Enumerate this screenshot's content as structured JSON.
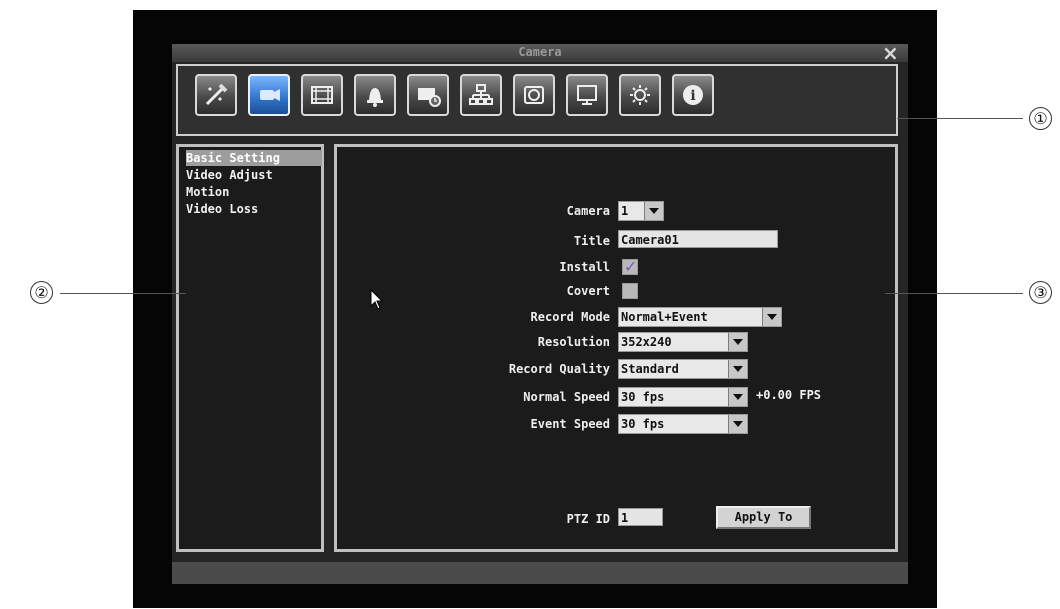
{
  "window": {
    "title": "Camera"
  },
  "toolbar": {
    "items": [
      {
        "name": "quick-setup-icon"
      },
      {
        "name": "camera-icon",
        "active": true
      },
      {
        "name": "record-icon"
      },
      {
        "name": "alarm-icon"
      },
      {
        "name": "schedule-icon"
      },
      {
        "name": "network-icon"
      },
      {
        "name": "device-icon"
      },
      {
        "name": "display-icon"
      },
      {
        "name": "system-icon"
      },
      {
        "name": "info-icon"
      }
    ]
  },
  "sidebar": {
    "items": [
      {
        "label": "Basic Setting",
        "selected": true
      },
      {
        "label": "Video Adjust"
      },
      {
        "label": "Motion"
      },
      {
        "label": "Video Loss"
      }
    ]
  },
  "form": {
    "camera_label": "Camera",
    "camera_value": "1",
    "title_label": "Title",
    "title_value": "Camera01",
    "install_label": "Install",
    "covert_label": "Covert",
    "record_mode_label": "Record Mode",
    "record_mode_value": "Normal+Event",
    "resolution_label": "Resolution",
    "resolution_value": "352x240",
    "record_quality_label": "Record Quality",
    "record_quality_value": "Standard",
    "normal_speed_label": "Normal Speed",
    "normal_speed_value": "30 fps",
    "normal_speed_extra": "+0.00 FPS",
    "event_speed_label": "Event Speed",
    "event_speed_value": "30 fps",
    "ptz_id_label": "PTZ ID",
    "ptz_id_value": "1",
    "apply_label": "Apply To"
  },
  "callouts": [
    "①",
    "②",
    "③"
  ],
  "colors": {
    "accent": "#2f73c9",
    "panel": "#1b1b1b",
    "border": "#bfbfbf"
  }
}
